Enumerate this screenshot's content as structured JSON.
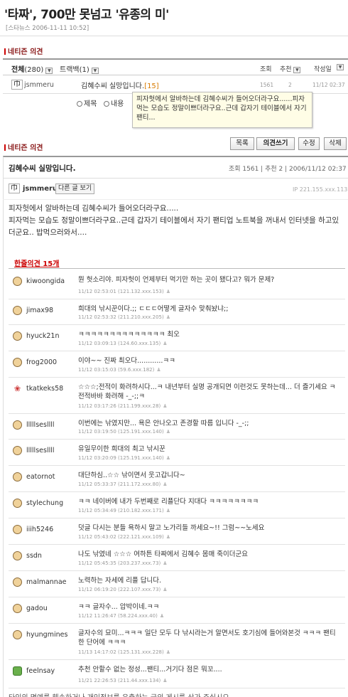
{
  "article": {
    "title": "'타짜', 700만 못넘고 '유종의 미'",
    "meta": "[스타뉴스 2006-11-11 10:52]"
  },
  "netizen_list": {
    "section_title": "네티즌 의견",
    "tab_all_label": "전체",
    "tab_all_count": "(280)",
    "tab_trackback_label": "트랙백",
    "tab_trackback_count": "(1)",
    "dropdown_glyph": "▼",
    "col_views": "조회",
    "col_recommend": "추천",
    "col_author": "작성일",
    "row": {
      "author": "jsmmeru",
      "avatar_char": "巾",
      "title": "김혜수씨 실망입니다.",
      "count": "[15]",
      "views": "1561",
      "recommend": "2",
      "date": "11/12 02:37"
    },
    "search_option_1": "제목",
    "search_option_2": "내용",
    "tooltip": "피자헛에서 알바하는데 김혜수씨가 들어오더라구요......피자먹는 모습도 정말이쁘더라구요..근데 갑자기 테이블에서 자기 팬티..."
  },
  "post": {
    "section_title": "네티즌 의견",
    "buttons": {
      "list": "목록",
      "write": "의견쓰기",
      "edit": "수정",
      "delete": "삭제"
    },
    "title": "김혜수씨 실망입니다.",
    "meta": "조회 1561 | 추천 2 | 2006/11/12 02:37",
    "author": "jsmmeru",
    "other_posts_btn": "다른 글 보기",
    "ip": "IP 221.155.xxx.113",
    "body": "피자헛에서 알바하는데 김혜수씨가 들어오더라구요.....\n피자먹는 모습도 정말이쁘더라구요..근데 갑자기 테이블에서 자기 팬티업 노트북을 꺼내서 인터넷을 하고있더군요.. 밥먹으러와서....",
    "comments_title": "한줄의견 15개"
  },
  "comments": [
    {
      "user": "kiwoongida",
      "text": "뭔 헛소리야. 피자헛이 언제부터 먹기만 하는 곳이 됐다고? 뭐가 문제?",
      "date": "11/12 02:53:01 (121.132.xxx.153)",
      "face": "normal"
    },
    {
      "user": "jimax98",
      "text": "희대의 낚시꾼이다.;; ㄷㄷㄷ어떻게 글자수 맞춰놨냐;;",
      "date": "11/12 02:53:32 (211.210.xxx.205)",
      "face": "normal"
    },
    {
      "user": "hyuck21n",
      "text": "ㅋㅋㅋㅋㅋㅋㅋㅋㅋㅋㅋㅋㅋㅋ 최오",
      "date": "11/12 03:09:13 (124.60.xxx.135)",
      "face": "normal"
    },
    {
      "user": "frog2000",
      "text": "이야~~ 진짜 최오다............ㅋㅋ",
      "date": "11/12 03:15:03 (59.6.xxx.182)",
      "face": "normal"
    },
    {
      "user": "tkatkeks58",
      "text": "☆☆☆;전적이 화려하시다...ㅋ 내년부터 실명 공개되면 이런것도 못하는데... 더 즐기세요 ㅋ전적바바 화려해 -_-;;ㅋ",
      "date": "11/12 03:17:26 (211.199.xxx.28)",
      "face": "star"
    },
    {
      "user": "lllllsesllll",
      "text": "이번에는 낚였지만... 욕은 안나오고 존경할 따름 입니다 -_-;;",
      "date": "11/12 03:19:50 (125.191.xxx.140)",
      "face": "normal"
    },
    {
      "user": "lllllsesllll",
      "text": "유일무이한 희대의 최고 낚시꾼",
      "date": "11/12 03:20:09 (125.191.xxx.140)",
      "face": "normal"
    },
    {
      "user": "eatornot",
      "text": "대단하심..☆☆ 낚이면서 웃고갑니다~",
      "date": "11/12 05:33:37 (211.172.xxx.80)",
      "face": "normal"
    },
    {
      "user": "stylechung",
      "text": "ㅋㅋ 네이버에 내가 두번째로 리플단다 지대다 ㅋㅋㅋㅋㅋㅋㅋㅋ",
      "date": "11/12 05:34:49 (210.182.xxx.171)",
      "face": "normal"
    },
    {
      "user": "iiih5246",
      "text": "덧글 다시는 분들 욕하시 말고 노가리들 까세요~!! 그럼~~노세요",
      "date": "11/12 05:43:02 (222.121.xxx.109)",
      "face": "normal"
    },
    {
      "user": "ssdn",
      "text": "나도 낚였네 ☆☆☆ 여하튼 타짜에서 김혜수 몸매 죽이더군요",
      "date": "11/12 05:45:35 (203.237.xxx.73)",
      "face": "normal"
    },
    {
      "user": "malmannae",
      "text": "노력하는 자세에 리플 답니다.",
      "date": "11/12 06:19:20 (222.107.xxx.73)",
      "face": "normal"
    },
    {
      "user": "gadou",
      "text": "ㅋㅋ 글자수... 압박이네.ㅋㅋ",
      "date": "11/12 11:26:47 (58.224.xxx.40)",
      "face": "normal"
    },
    {
      "user": "hyungmines",
      "text": "글자수의 묘미...ㅋㅋㅋ 일단 모두 다 낚시라는거 알면서도 호기심에 들어와본것 ㅋㅋㅋ 팬티 한 단어에 ㅋㅋㅋ",
      "date": "11/13 14:17:02 (125.131.xxx.228)",
      "face": "normal"
    },
    {
      "user": "feelnsay",
      "text": "추천 안할수 없는 정성...팬티...거기다 점은 뭐꼬....",
      "date": "11/21 22:26:53 (211.44.xxx.134)",
      "face": "flower"
    }
  ],
  "bottom_note": "타인의 명예를 훼손하거나 개인정보를 유출하는 글의 게시를 삼가 주십시오."
}
